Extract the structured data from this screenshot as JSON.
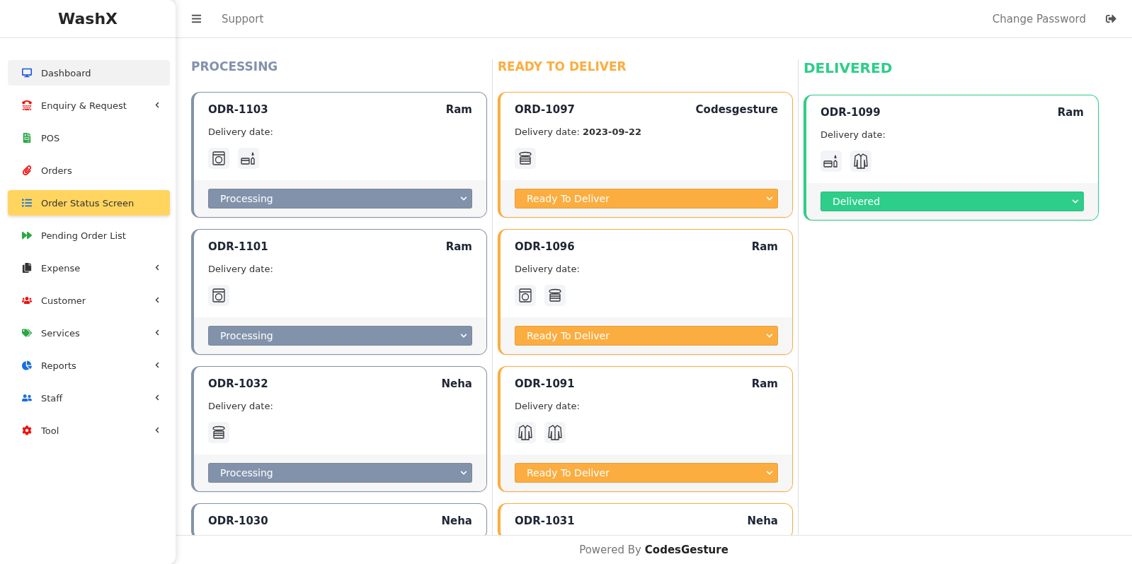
{
  "brand": "WashX",
  "sidebar": {
    "items": [
      {
        "label": "Dashboard",
        "selected": false,
        "highlighted": true,
        "expandable": false
      },
      {
        "label": "Enquiry & Request",
        "selected": false,
        "highlighted": false,
        "expandable": true
      },
      {
        "label": "POS",
        "selected": false,
        "highlighted": false,
        "expandable": false
      },
      {
        "label": "Orders",
        "selected": false,
        "highlighted": false,
        "expandable": false
      },
      {
        "label": "Order Status Screen",
        "selected": true,
        "highlighted": false,
        "expandable": false
      },
      {
        "label": "Pending Order List",
        "selected": false,
        "highlighted": false,
        "expandable": false
      },
      {
        "label": "Expense",
        "selected": false,
        "highlighted": false,
        "expandable": true
      },
      {
        "label": "Customer",
        "selected": false,
        "highlighted": false,
        "expandable": true
      },
      {
        "label": "Services",
        "selected": false,
        "highlighted": false,
        "expandable": true
      },
      {
        "label": "Reports",
        "selected": false,
        "highlighted": false,
        "expandable": true
      },
      {
        "label": "Staff",
        "selected": false,
        "highlighted": false,
        "expandable": true
      },
      {
        "label": "Tool",
        "selected": false,
        "highlighted": false,
        "expandable": true
      }
    ]
  },
  "topbar": {
    "link": "Support",
    "right_link": "Change Password"
  },
  "columns": [
    {
      "title": "PROCESSING",
      "color": "#8392ab",
      "cards": [
        {
          "order": "ODR-1103",
          "customer": "Ram",
          "date_label": "Delivery date:",
          "services": [
            {
              "kind": "washer"
            },
            {
              "kind": "drycleaning"
            }
          ],
          "status": "Processing"
        },
        {
          "order": "ODR-1101",
          "customer": "Ram",
          "date_label": "Delivery date:",
          "services": [
            {
              "kind": "washer"
            }
          ],
          "status": "Processing"
        },
        {
          "order": "ODR-1032",
          "customer": "Neha",
          "date_label": "Delivery date:",
          "services": [
            {
              "kind": "press"
            }
          ],
          "status": "Processing"
        },
        {
          "order": "ODR-1030",
          "customer": "Neha"
        }
      ]
    },
    {
      "title": "READY TO DELIVER",
      "color": "#fbad40",
      "cards": [
        {
          "order": "ORD-1097",
          "customer": "Codesgesture",
          "date_label": "Delivery date:",
          "date": "2023-09-22",
          "services": [
            {
              "kind": "press"
            }
          ],
          "status": "Ready To Deliver"
        },
        {
          "order": "ODR-1096",
          "customer": "Ram",
          "date_label": "Delivery date:",
          "services": [
            {
              "kind": "washer"
            },
            {
              "kind": "press"
            }
          ],
          "status": "Ready To Deliver"
        },
        {
          "order": "ODR-1091",
          "customer": "Ram",
          "date_label": "Delivery date:",
          "services": [
            {
              "kind": "shirt"
            },
            {
              "kind": "shirt"
            }
          ],
          "status": "Ready To Deliver"
        },
        {
          "order": "ODR-1031",
          "customer": "Neha"
        }
      ]
    },
    {
      "title": "DELIVERED",
      "color": "#2dce89",
      "cards": [
        {
          "order": "ODR-1099",
          "customer": "Ram",
          "date_label": "Delivery date:",
          "services": [
            {
              "kind": "drycleaning"
            },
            {
              "kind": "shirt"
            }
          ],
          "status": "Delivered"
        }
      ]
    }
  ],
  "footer": {
    "prefix": "Powered By",
    "company": "CodesGesture"
  }
}
